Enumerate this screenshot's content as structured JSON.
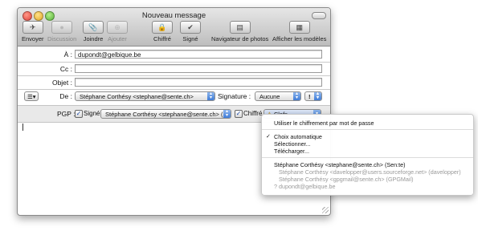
{
  "window": {
    "title": "Nouveau message"
  },
  "toolbar": {
    "send": "Envoyer",
    "discussion": "Discussion",
    "attach": "Joindre",
    "add": "Ajouter",
    "encrypted": "Chiffré",
    "signed": "Signé",
    "photo_browser": "Navigateur de photos",
    "show_templates": "Afficher les modèles"
  },
  "headers": {
    "to_label": "À :",
    "to_value": "dupondt@gelbique.be",
    "cc_label": "Cc :",
    "cc_value": "",
    "subject_label": "Objet :",
    "subject_value": "",
    "from_label": "De :",
    "from_value": "Stéphane Corthésy <stephane@sente.ch>",
    "signature_label": "Signature :",
    "signature_value": "Aucune",
    "priority_value": "!"
  },
  "pgp": {
    "label": "PGP :",
    "signed_label": "Signé",
    "signed_checked": true,
    "signer_value": "Stéphane Corthésy <stephane@sente.ch> (Se",
    "encrypted_label": "Chiffré",
    "encrypted_checked": true,
    "keys_label": "Clefs"
  },
  "menu": {
    "passphrase": "Utiliser le chiffrement par mot de passe",
    "auto": "Choix automatique",
    "select": "Sélectionner...",
    "download": "Télécharger...",
    "key_main": "Stéphane Corthésy <stephane@sente.ch> (Sen:te)",
    "key_alt1": "Stéphane Corthésy <davelopper@users.sourceforge.net> (davelopper)",
    "key_alt2": "Stéphane Corthésy <gpgmail@sente.ch> (GPGMail)",
    "key_unknown": "dupondt@gelbique.be",
    "unknown_marker": "?"
  }
}
